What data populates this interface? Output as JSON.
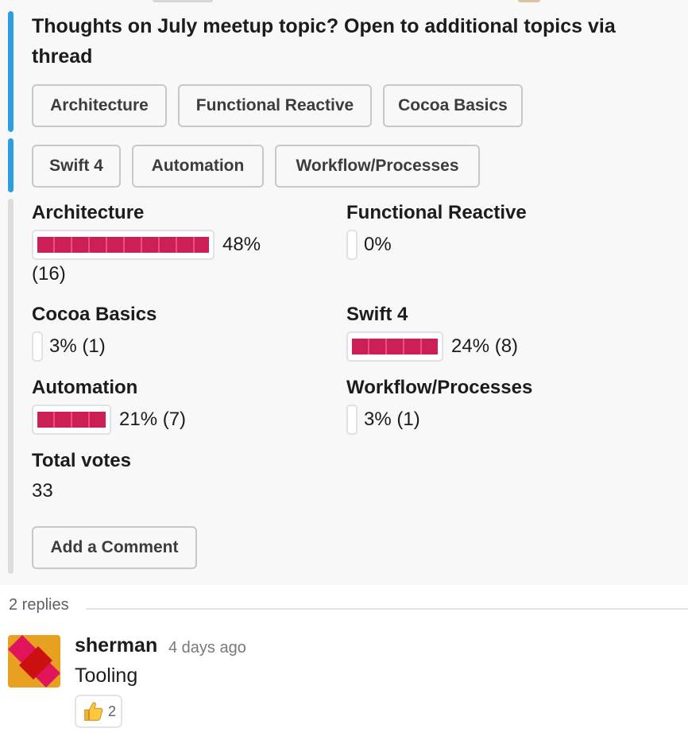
{
  "poll": {
    "question": "Thoughts on July meetup topic? Open to additional topics via thread",
    "options": [
      "Architecture",
      "Functional Reactive",
      "Cocoa Basics",
      "Swift 4",
      "Automation",
      "Workflow/Processes"
    ],
    "results": [
      {
        "name": "Architecture",
        "percent": 48,
        "count_text": "(16)",
        "percent_text": "48%"
      },
      {
        "name": "Functional Reactive",
        "percent": 0,
        "percent_text": "0%"
      },
      {
        "name": "Cocoa Basics",
        "percent": 3,
        "percent_text": "3% (1)"
      },
      {
        "name": "Swift 4",
        "percent": 24,
        "percent_text": "24% (8)"
      },
      {
        "name": "Automation",
        "percent": 21,
        "percent_text": "21% (7)"
      },
      {
        "name": "Workflow/Processes",
        "percent": 3,
        "percent_text": "3% (1)"
      }
    ],
    "total_label": "Total votes",
    "total_value": "33",
    "comment_button": "Add a Comment",
    "bar_color": "#cc1f55"
  },
  "thread": {
    "replies_label": "2 replies",
    "reply": {
      "author": "sherman",
      "time": "4 days ago",
      "text": "Tooling",
      "reaction": {
        "icon": "thumbs-up-icon",
        "count": "2"
      }
    }
  },
  "colors": {
    "accent_blue": "#2d9ee0",
    "background": "#f8f8f8"
  }
}
